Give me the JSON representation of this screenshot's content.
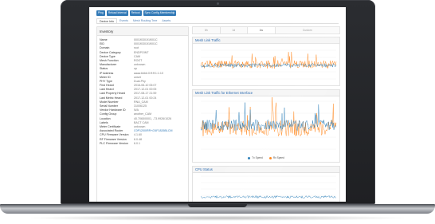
{
  "colors": {
    "accent": "#337ab7",
    "tx_speed": "#1f77b4",
    "rx_speed": "#ff7f0e",
    "panel_title": "#2a6ab0"
  },
  "toolbar": {
    "buttons": [
      "Ping",
      "Reload Interval",
      "Reboot",
      "Sync Config Membership"
    ]
  },
  "tabs": [
    "Device Info",
    "Events",
    "Mesh Routing Tree",
    "Assets"
  ],
  "inventory": {
    "title": "Inventory",
    "rows": [
      {
        "k": "Name",
        "v": "0001f0301f1f001C"
      },
      {
        "k": "EID",
        "v": "0001f0301f1f001C"
      },
      {
        "k": "Domain",
        "v": "root"
      },
      {
        "k": "Device Category",
        "v": "ENDPOINT"
      },
      {
        "k": "Device Type",
        "v": "CAM"
      },
      {
        "k": "Mesh Function",
        "v": "ROOT"
      },
      {
        "k": "Manufacturer",
        "v": "unknown"
      },
      {
        "k": "Status",
        "v": "up"
      },
      {
        "k": "IP Address",
        "v": "aaaa:bbbb:0:ff:ff:1:1:10"
      },
      {
        "k": "Meter ID",
        "v": "unset"
      },
      {
        "k": "PHY Type",
        "v": "Dual-Phy"
      },
      {
        "k": "First Heard",
        "v": "2016-06-10 05:07"
      },
      {
        "k": "Last Heard",
        "v": "2017-12-01 00:05"
      },
      {
        "k": "Last Property Heard",
        "v": "2017-08-17 21:59"
      },
      {
        "k": "Last Metric Heard",
        "v": "2017-12-01 00:24"
      },
      {
        "k": "Model Number",
        "v": "RNA_CAM"
      },
      {
        "k": "Serial Number",
        "v": "31006125"
      },
      {
        "k": "Vendor Hardware ID",
        "v": "N/A"
      },
      {
        "k": "Config Group",
        "v": "another_CAM"
      },
      {
        "k": "Location",
        "v": "40.7065/0001, -73.9926/1026"
      },
      {
        "k": "Labels",
        "v": "BACT CAM"
      },
      {
        "k": "Meter Certificate",
        "v": "unknown"
      },
      {
        "k": "Associated Router",
        "v": "C0P1200/RR+/24F1826BLCM",
        "link": true
      },
      {
        "k": "CPU Firmware Version",
        "v": "4.1.60"
      },
      {
        "k": "RF Firmware Version",
        "v": "6.0.48"
      },
      {
        "k": "PLC Firmware Version",
        "v": "6.0.1"
      }
    ]
  },
  "range_tabs": [
    "6h",
    "1d",
    "1w",
    "Custom"
  ],
  "panels": {
    "mesh_link": {
      "title": "Mesh Link Traffic"
    },
    "ethernet": {
      "title": "Mesh Link Traffic for Ethernet Interface"
    },
    "cpu": {
      "title": "CPU Status"
    }
  },
  "legend": {
    "tx": "Tx Speed",
    "rx": "Rx Speed"
  }
}
